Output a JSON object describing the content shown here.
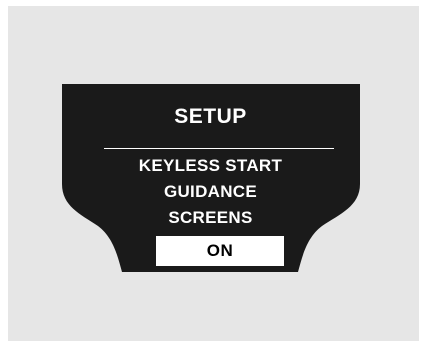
{
  "screen": {
    "title": "SETUP",
    "message_lines": [
      "KEYLESS START",
      "GUIDANCE",
      "SCREENS"
    ],
    "option_value": "ON"
  },
  "colors": {
    "panel_background": "#e6e6e6",
    "display_background": "#1a1a1a",
    "text": "#ffffff",
    "selected_option_background": "#ffffff",
    "selected_option_text": "#000000"
  }
}
